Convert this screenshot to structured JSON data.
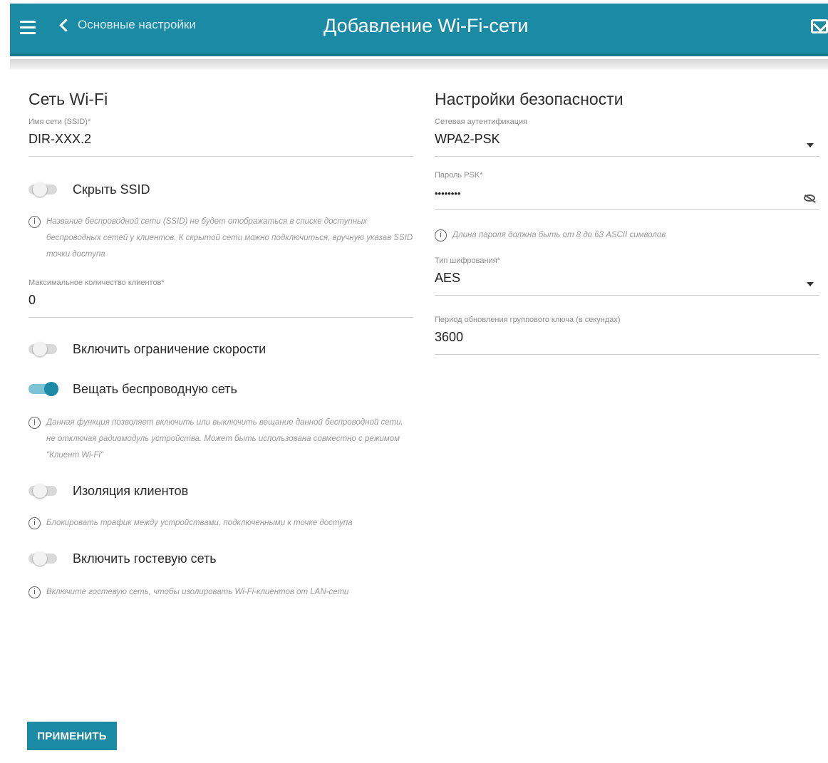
{
  "header": {
    "back_label": "Основные настройки",
    "title": "Добавление Wi-Fi-сети"
  },
  "wifi": {
    "section_title": "Сеть Wi-Fi",
    "ssid": {
      "label": "Имя сети (SSID)*",
      "value": "DIR-XXX.2"
    },
    "hide_ssid": {
      "label": "Скрыть SSID",
      "enabled": false
    },
    "hide_ssid_info": "Название беспроводной сети (SSID) не будет отображаться в списке доступных беспроводных сетей у клиентов. К скрытой сети можно подключиться, вручную указав SSID точки доступа",
    "max_clients": {
      "label": "Максимальное количество клиентов*",
      "value": "0"
    },
    "speed_limit": {
      "label": "Включить ограничение скорости",
      "enabled": false
    },
    "broadcast": {
      "label": "Вещать беспроводную сеть",
      "enabled": true
    },
    "broadcast_info": "Данная функция позволяет включить или выключить вещание данной беспроводной сети, не отключая радиомодуль устройства. Может быть использована совместно с режимом \"Клиент Wi-Fi\"",
    "isolation": {
      "label": "Изоляция клиентов",
      "enabled": false
    },
    "isolation_info": "Блокировать трафик между устройствами, подключенными к точке доступа",
    "guest": {
      "label": "Включить гостевую сеть",
      "enabled": false
    },
    "guest_info": "Включите гостевую сеть, чтобы изолировать Wi-Fi-клиентов от LAN-сети"
  },
  "security": {
    "section_title": "Настройки безопасности",
    "auth": {
      "label": "Сетевая аутентификация",
      "value": "WPA2-PSK"
    },
    "psk": {
      "label": "Пароль PSK*",
      "value": "••••••••"
    },
    "psk_info": "Длина пароля должна быть от 8 до 63 ASCII символов",
    "encryption": {
      "label": "Тип шифрования*",
      "value": "AES"
    },
    "group_key": {
      "label": "Период обновления группового ключа (в секундах)",
      "value": "3600"
    }
  },
  "apply_label": "ПРИМЕНИТЬ",
  "colors": {
    "accent": "#1b8aa4",
    "toggle_on_track": "#7cc3d6"
  },
  "icons": [
    "menu-icon",
    "chevron-left-icon",
    "mail-icon",
    "info-icon",
    "eye-off-icon",
    "dropdown-arrow-icon"
  ]
}
